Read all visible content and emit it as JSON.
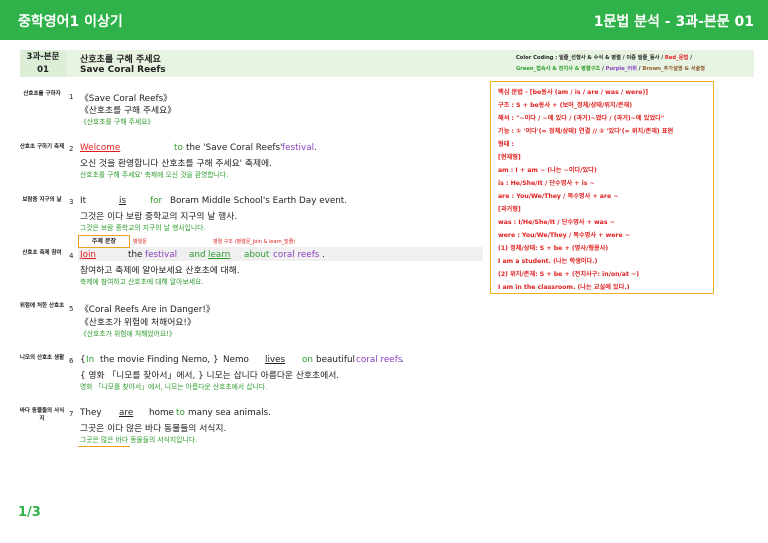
{
  "header": {
    "left": "중학영어1 이상기",
    "right": "1문법 분석 - 3과-본문 01"
  },
  "title": {
    "label1": "3과-본문",
    "label2": "01",
    "t1": "산호초를 구해 주세요",
    "t2": "Save Coral Reefs"
  },
  "color_coding": {
    "line1_black": "Color Coding : 밑줄_선행사 & 수식 & 병렬 / 이중 밑줄_동사 / ",
    "line1_red": "Red_문법",
    "line1_end": " /",
    "line2_green": "Green_접속사 & 전치사 & 병렬구조",
    "line2_sep": " / ",
    "line2_purple": "Purple_어휘",
    "line2_sep2": " / ",
    "line2_brown": "Brown_추가설명 & 서술형"
  },
  "rows": {
    "r1": {
      "label": "산호초를 구하자",
      "num": "1",
      "en": "《Save Coral Reefs》",
      "ko": "《산호초를 구해 주세요》",
      "sub": "《산호초를 구해 주세요》"
    },
    "r2": {
      "label": "산호초 구하기 축제",
      "num": "2",
      "w1": "Welcome",
      "w2": "to",
      "w3": "the 'Save Coral Reefs'",
      "w4": "festival",
      "w5": ".",
      "ko": "오신 것을 환영합니다     산호초를 구해 주세요' 축제에.",
      "sub": "산호초를 구해 주세요' 축제에 오신 것을 환영합니다."
    },
    "r3": {
      "label": "보람중 지구의 날",
      "num": "3",
      "w1": "It",
      "w2": "is",
      "w3": "for",
      "w4": "Boram Middle School's Earth Day event.",
      "ko": "그것은       이다      보람 중학교의 지구의 날 행사.",
      "sub": "그것은 보람 중학교의 지구의 날 행사입니다."
    },
    "r4": {
      "label": "산호초 축제 참여",
      "num": "4",
      "box": "주제 문장",
      "note1": "병렬문",
      "note2": "병렬 구조 (병렬문_Join & learn_밑줄)",
      "w1": "Join",
      "w2": "the",
      "w3": "festival",
      "w4": "and",
      "w5": "learn",
      "w6": "about",
      "w7": "coral reefs",
      "w8": ".",
      "ko": "참여하고     축제에                     알아보세요     산호초에 대해.",
      "sub": "축제에 참여하고 산호초에 대해 알아보세요."
    },
    "r5": {
      "label": "위험에 처한 산호초",
      "num": "5",
      "en": "《Coral Reefs Are in Danger!》",
      "ko": "《산호초가 위험에 처해어요!》",
      "sub": "《산호초가 위험에 처해었어요!》"
    },
    "r6": {
      "label": "니모의 산호초 생활",
      "num": "6",
      "w1": "{",
      "w2": "In",
      "w3": "the movie Finding Nemo, }",
      "w4": "Nemo",
      "w5": "lives",
      "w6": "on",
      "w7": "beautiful",
      "w8": "coral reefs",
      "w9": ".",
      "ko": "{ 영화 「니모를 찾아서」에서, }               니모는        삽니다      아름다운 산호초에서.",
      "sub": "영화 「니모를 찾아서」에서, 니모는 아름다운 산호초에서 삽니다."
    },
    "r7": {
      "label": "바다 동물들의 서식지",
      "num": "7",
      "w1": "They",
      "w2": "are",
      "w3": "home",
      "w4": "to",
      "w5": "many sea animals.",
      "ko": "그곳은       이다       많은 바다 동물들의 서식지.",
      "sub": "그곳은 많은 바다 동물들의 서식지입니다."
    }
  },
  "grammar": {
    "lines": [
      "핵심 문법 - [be동사 (am / is / are / was / were)]",
      "구조 : S + be동사 + (보어_정체/상태/위치/존재)",
      "해석 : \"~이다 / ~에 있다 / (과거)~였다 / (과거)~에 있었다\"",
      "기능 : ① '이다'(= 정체/상태) 연결 // ② '있다'(= 위치/존재) 표현",
      "형태 :",
      "[현재형]",
      "am : I + am ~ (나는 ~이다/있다)",
      "is : He/She/It / 단수명사 + is ~",
      "are : You/We/They / 복수명사 + are ~",
      "[과거형]",
      "was : I/He/She/It / 단수명사 + was ~",
      "were : You/We/They / 복수명사 + were ~",
      "(1) 정체/상태: S + be + (명사/형용사)",
      "I am a student. (나는 학생이다.)",
      "(2) 위치/존재: S + be + (전치사구: in/on/at ~)",
      "I am in the classroom. (나는 교실에 있다.)"
    ]
  },
  "page": "1/3"
}
